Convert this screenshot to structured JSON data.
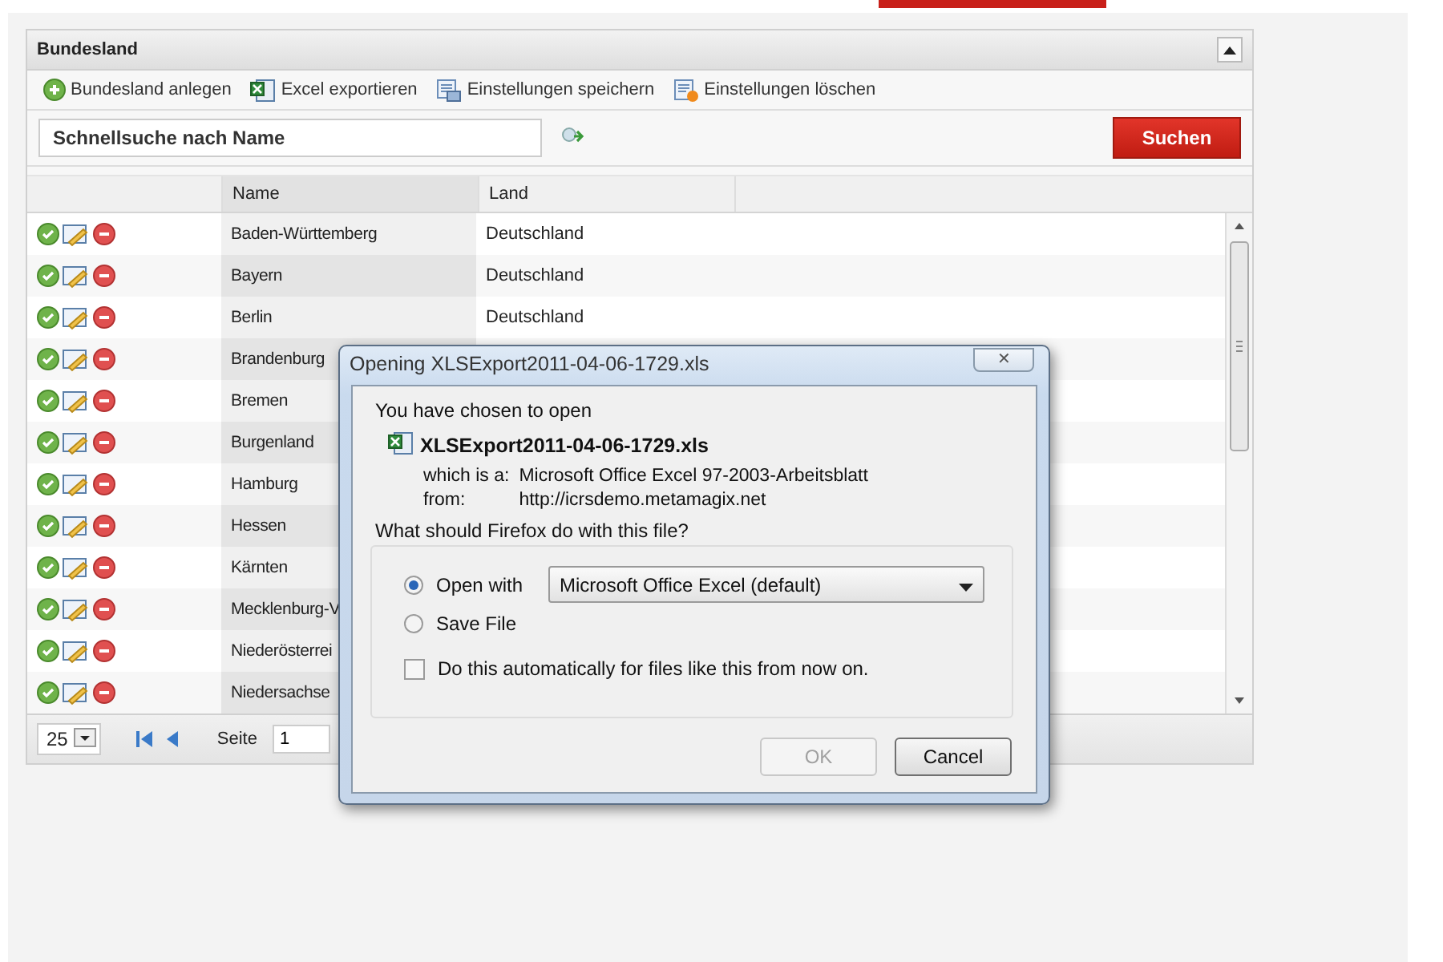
{
  "panel": {
    "title": "Bundesland"
  },
  "toolbar": [
    {
      "label": "Bundesland anlegen",
      "kind": "add"
    },
    {
      "label": "Excel exportieren",
      "kind": "excel"
    },
    {
      "label": "Einstellungen speichern",
      "kind": "save"
    },
    {
      "label": "Einstellungen löschen",
      "kind": "delete"
    }
  ],
  "search": {
    "placeholder": "Schnellsuche nach Name",
    "button": "Suchen"
  },
  "grid": {
    "columns": [
      "Name",
      "Land"
    ],
    "rows": [
      {
        "name": "Baden-Württemberg",
        "land": "Deutschland"
      },
      {
        "name": "Bayern",
        "land": "Deutschland"
      },
      {
        "name": "Berlin",
        "land": "Deutschland"
      },
      {
        "name": "Brandenburg"
      },
      {
        "name": "Bremen"
      },
      {
        "name": "Burgenland"
      },
      {
        "name": "Hamburg"
      },
      {
        "name": "Hessen"
      },
      {
        "name": "Kärnten"
      },
      {
        "name": "Mecklenburg-V"
      },
      {
        "name": "Niederösterrei"
      },
      {
        "name": "Niedersachse"
      }
    ]
  },
  "pager": {
    "page_size": "25",
    "page_label": "Seite",
    "page": "1"
  },
  "dialog": {
    "title": "Opening XLSExport2011-04-06-1729.xls",
    "close": "✕",
    "intro": "You have chosen to open",
    "file_name": "XLSExport2011-04-06-1729.xls",
    "type_label": "which is a:",
    "type_value": "Microsoft Office Excel 97-2003-Arbeitsblatt",
    "from_label": "from:",
    "from_value": "http://icrsdemo.metamagix.net",
    "question": "What should Firefox do with this file?",
    "options": [
      {
        "label": "Open with",
        "selected": true
      },
      {
        "label": "Save File",
        "selected": false
      }
    ],
    "application": "Microsoft Office Excel (default)",
    "auto": {
      "label": "Do this automatically for files like this from now on.",
      "checked": false
    },
    "buttons": [
      {
        "label": "OK",
        "disabled": true
      },
      {
        "label": "Cancel",
        "disabled": false
      }
    ]
  }
}
